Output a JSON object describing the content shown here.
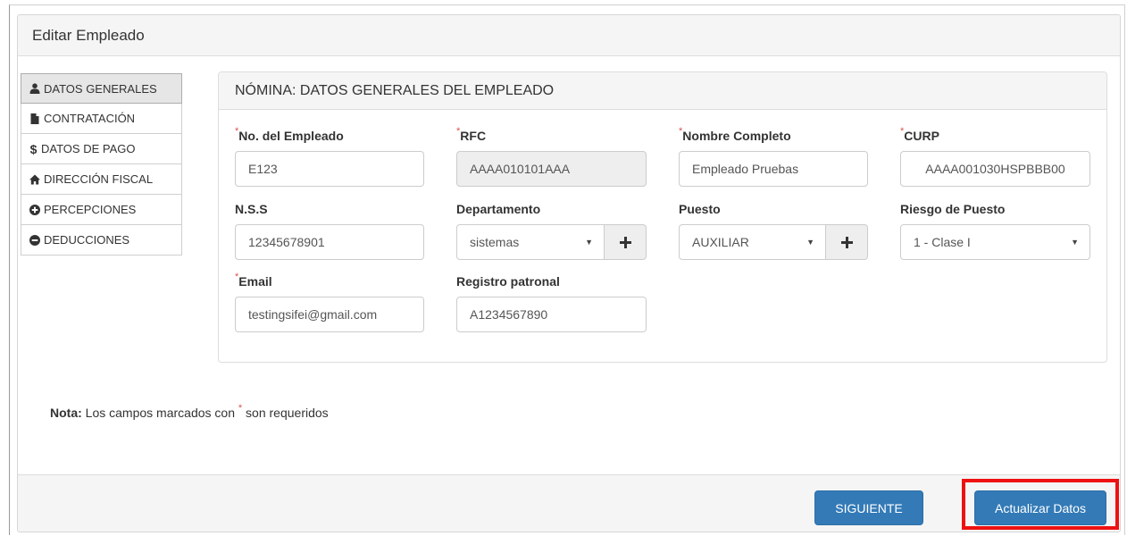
{
  "modal": {
    "title": "Editar Empleado"
  },
  "tabs": [
    {
      "label": "DATOS GENERALES",
      "icon": "user-icon",
      "active": true
    },
    {
      "label": "CONTRATACIÓN",
      "icon": "file-icon",
      "active": false
    },
    {
      "label": "DATOS DE PAGO",
      "icon": "dollar-icon",
      "active": false
    },
    {
      "label": "DIRECCIÓN FISCAL",
      "icon": "home-icon",
      "active": false
    },
    {
      "label": "PERCEPCIONES",
      "icon": "plus-circle-icon",
      "active": false
    },
    {
      "label": "DEDUCCIONES",
      "icon": "minus-circle-icon",
      "active": false
    }
  ],
  "panel": {
    "heading": "NÓMINA: DATOS GENERALES DEL EMPLEADO"
  },
  "required_mark": "*",
  "fields": {
    "employee_number": {
      "label": "No. del Empleado",
      "value": "E123"
    },
    "rfc": {
      "label": "RFC",
      "value": "AAAA010101AAA"
    },
    "full_name": {
      "label": "Nombre Completo",
      "value": "Empleado Pruebas"
    },
    "curp": {
      "label": "CURP",
      "value": "AAAA001030HSPBBB00"
    },
    "nss": {
      "label": "N.S.S",
      "value": "12345678901"
    },
    "department": {
      "label": "Departamento",
      "value": "sistemas"
    },
    "position": {
      "label": "Puesto",
      "value": "AUXILIAR"
    },
    "position_risk": {
      "label": "Riesgo de Puesto",
      "value": "1 - Clase I"
    },
    "email": {
      "label": "Email",
      "value": "testingsifei@gmail.com"
    },
    "employer_registration": {
      "label": "Registro patronal",
      "value": "A1234567890"
    }
  },
  "note": {
    "bold": "Nota:",
    "before": " Los campos marcados con ",
    "after": " son requeridos"
  },
  "footer": {
    "next_label": "SIGUIENTE",
    "update_label": "Actualizar Datos"
  },
  "colors": {
    "primary": "#337ab7",
    "required": "#d9534f",
    "highlight": "#ee1111"
  }
}
